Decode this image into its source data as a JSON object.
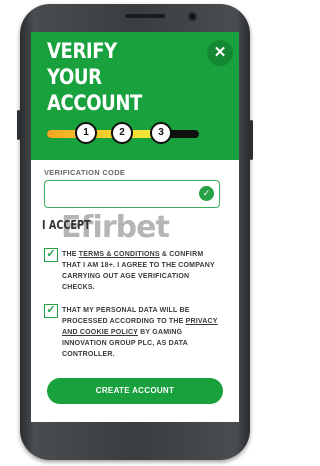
{
  "header": {
    "title": "VERIFY YOUR\nACCOUNT",
    "close_symbol": "✕",
    "accent": "#18a13c"
  },
  "progress": {
    "steps": [
      "1",
      "2",
      "3"
    ],
    "current_step": 3,
    "fraction_complete": 0.72
  },
  "form": {
    "code_label": "VERIFICATION CODE",
    "code_value": "",
    "code_valid": true
  },
  "watermark": "Efirbet",
  "accept": {
    "heading": "I ACCEPT",
    "terms": {
      "checked": true,
      "pre": "THE ",
      "link": "TERMS & CONDITIONS",
      "post": " & CONFIRM THAT I AM 18+. I AGREE TO THE COMPANY CARRYING OUT AGE VERIFICATION CHECKS."
    },
    "privacy": {
      "checked": true,
      "pre": "THAT MY PERSONAL DATA WILL BE PROCESSED ACCORDING TO THE ",
      "link": "PRIVACY AND COOKIE POLICY",
      "post": " BY GAMING INNOVATION GROUP PLC, AS DATA CONTROLLER."
    }
  },
  "cta_label": "CREATE ACCOUNT"
}
